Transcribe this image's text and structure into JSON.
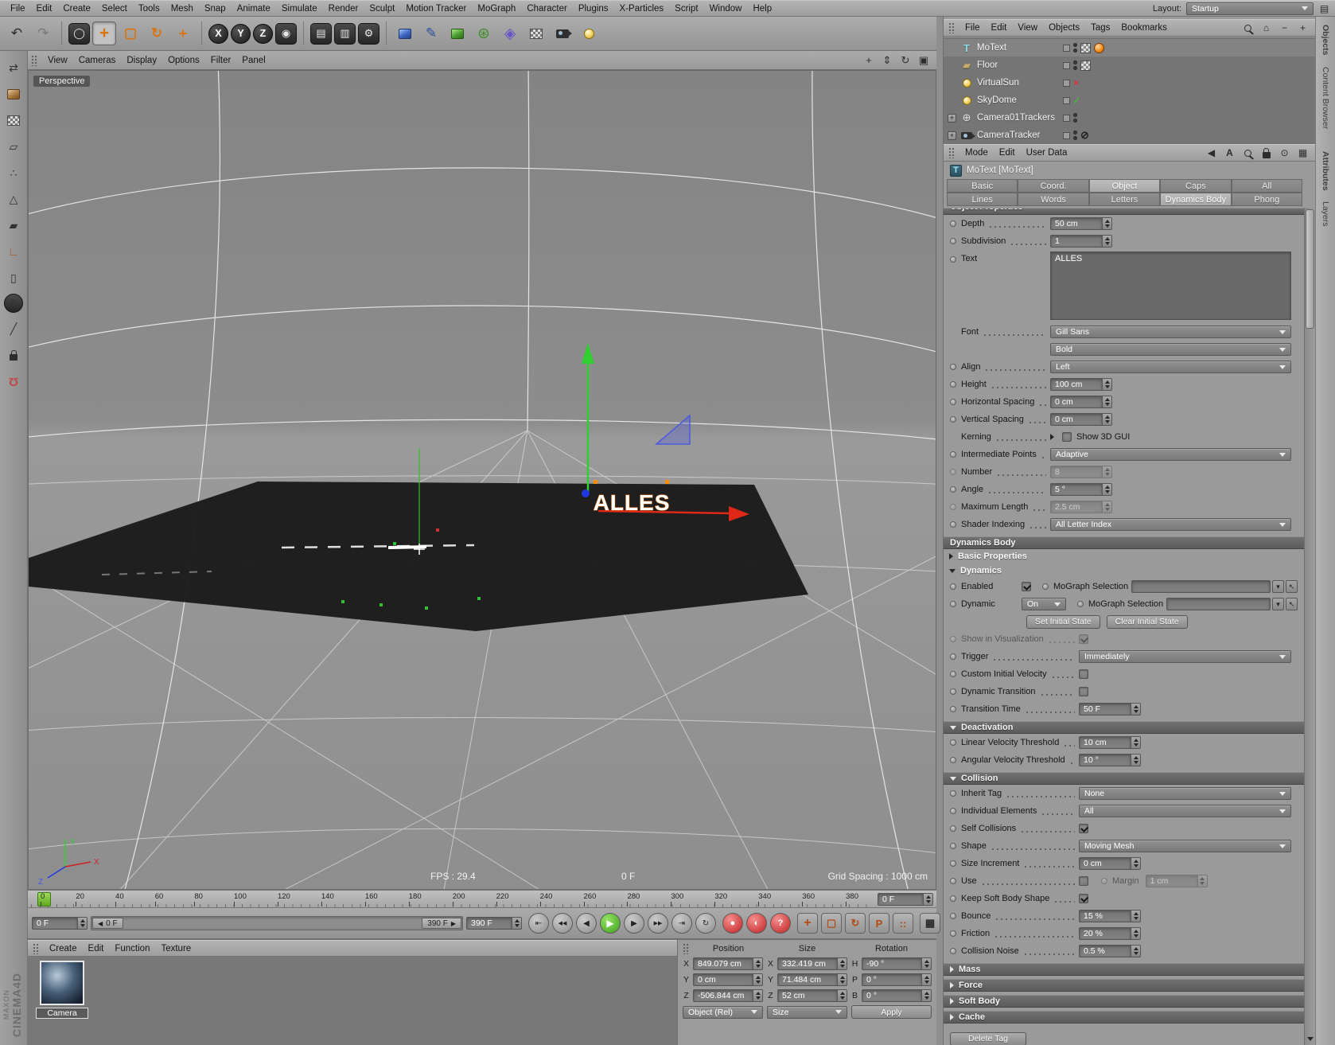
{
  "menubar": {
    "items": [
      "File",
      "Edit",
      "Create",
      "Select",
      "Tools",
      "Mesh",
      "Snap",
      "Animate",
      "Simulate",
      "Render",
      "Sculpt",
      "Motion Tracker",
      "MoGraph",
      "Character",
      "Plugins",
      "X-Particles",
      "Script",
      "Window",
      "Help"
    ],
    "layout_label": "Layout:",
    "layout_value": "Startup"
  },
  "toolbar": {
    "axis_x": "X",
    "axis_y": "Y",
    "axis_z": "Z",
    "icons": [
      "undo",
      "redo",
      "live-selection",
      "move-tool",
      "scale-tool",
      "rotate-tool",
      "last-tool",
      "x-axis-lock",
      "y-axis-lock",
      "z-axis-lock",
      "coordinate-system",
      "render-view",
      "render-to-picture-viewer",
      "edit-render-settings",
      "add-primitive",
      "add-spline",
      "add-generator",
      "add-mograph",
      "add-deformer",
      "add-environment",
      "add-camera",
      "add-light"
    ]
  },
  "left_palette": {
    "icons": [
      "make-editable",
      "model-mode",
      "texture-mode",
      "workplane-mode",
      "points-mode",
      "edges-mode",
      "polygons-mode",
      "axis-mode",
      "viewport-solo",
      "snap",
      "knife",
      "lock",
      "magnet-snap"
    ]
  },
  "viewport": {
    "menus": [
      "View",
      "Cameras",
      "Display",
      "Options",
      "Filter",
      "Panel"
    ],
    "view_label": "Perspective",
    "object_text": "ALLES",
    "fps": "FPS : 29.4",
    "frame": "0 F",
    "grid_spacing": "Grid Spacing : 1000 cm",
    "axis_x": "X",
    "axis_y": "Y",
    "axis_z": "Z"
  },
  "timeline": {
    "ticks": [
      "0",
      "20",
      "40",
      "60",
      "80",
      "100",
      "120",
      "140",
      "160",
      "180",
      "200",
      "220",
      "240",
      "260",
      "280",
      "300",
      "320",
      "340",
      "360",
      "380"
    ],
    "ruler_current": "0 F",
    "current_frame": "0 F",
    "range_start": "0 F",
    "range_end": "390 F",
    "duration": "390 F",
    "transport": [
      "goto-start",
      "previous-key",
      "previous-frame",
      "play-forward",
      "next-frame",
      "next-key",
      "goto-end",
      "loop"
    ],
    "record": [
      "record-keyframe",
      "autokeying",
      "keyframe-help"
    ],
    "record_toggles": [
      "record-position",
      "record-scale",
      "record-rotation",
      "record-parameter",
      "record-pla"
    ]
  },
  "material_manager": {
    "menus": [
      "Create",
      "Edit",
      "Function",
      "Texture"
    ],
    "materials": [
      {
        "name": "Camera"
      }
    ]
  },
  "coordinates": {
    "position": {
      "title": "Position",
      "x_label": "X",
      "x": "849.079 cm",
      "y_label": "Y",
      "y": "0 cm",
      "z_label": "Z",
      "z": "-506.844 cm",
      "mode": "Object (Rel)"
    },
    "size": {
      "title": "Size",
      "x_label": "X",
      "x": "332.419 cm",
      "y_label": "Y",
      "y": "71.484 cm",
      "z_label": "Z",
      "z": "52 cm",
      "mode": "Size"
    },
    "rotation": {
      "title": "Rotation",
      "h_label": "H",
      "h": "-90 °",
      "p_label": "P",
      "p": "0 °",
      "b_label": "B",
      "b": "0 °",
      "apply": "Apply"
    }
  },
  "object_manager": {
    "menus": [
      "File",
      "Edit",
      "View",
      "Objects",
      "Tags",
      "Bookmarks"
    ],
    "objects": [
      {
        "name": "MoText"
      },
      {
        "name": "Floor"
      },
      {
        "name": "VirtualSun"
      },
      {
        "name": "SkyDome"
      },
      {
        "name": "Camera01Trackers"
      },
      {
        "name": "CameraTracker"
      }
    ]
  },
  "attributes": {
    "menus": [
      "Mode",
      "Edit",
      "User Data"
    ],
    "title": "MoText [MoText]",
    "tabs": {
      "t1": "Basic",
      "t2": "Coord.",
      "t3": "Object",
      "t4": "Caps",
      "t5": "All",
      "t6": "Lines",
      "t7": "Words",
      "t8": "Letters",
      "t9": "Dynamics Body",
      "t10": "Phong"
    },
    "object_properties": {
      "section": "Object Properties",
      "depth_label": "Depth",
      "depth": "50 cm",
      "subdivision_label": "Subdivision",
      "subdivision": "1",
      "text_label": "Text",
      "text": "ALLES",
      "font_label": "Font",
      "font_name": "Gill Sans",
      "font_style": "Bold",
      "align_label": "Align",
      "align": "Left",
      "height_label": "Height",
      "height": "100 cm",
      "hspacing_label": "Horizontal Spacing",
      "hspacing": "0 cm",
      "vspacing_label": "Vertical Spacing",
      "vspacing": "0 cm",
      "kerning_label": "Kerning",
      "show_3d_gui_label": "Show 3D GUI",
      "intermediate_label": "Intermediate Points",
      "intermediate": "Adaptive",
      "number_label": "Number",
      "number": "8",
      "angle_label": "Angle",
      "angle": "5 °",
      "max_length_label": "Maximum Length",
      "max_length": "2.5 cm",
      "shader_label": "Shader Indexing",
      "shader": "All Letter Index"
    },
    "dynamics": {
      "section": "Dynamics Body",
      "basic_properties": "Basic Properties",
      "dynamics_sub": "Dynamics",
      "enabled_label": "Enabled",
      "mograph_selection_label": "MoGraph Selection",
      "dynamic_label": "Dynamic",
      "dynamic_value": "On",
      "mograph_selection2_label": "MoGraph Selection",
      "set_initial_state": "Set Initial State",
      "clear_initial_state": "Clear Initial State",
      "show_viz_label": "Show in Visualization",
      "trigger_label": "Trigger",
      "trigger": "Immediately",
      "custom_velocity_label": "Custom Initial Velocity",
      "dynamic_transition_label": "Dynamic Transition",
      "transition_time_label": "Transition Time",
      "transition_time": "50 F"
    },
    "deactivation": {
      "section": "Deactivation",
      "linear_label": "Linear Velocity Threshold",
      "linear": "10 cm",
      "angular_label": "Angular Velocity Threshold",
      "angular": "10 °"
    },
    "collision": {
      "section": "Collision",
      "inherit_label": "Inherit Tag",
      "inherit": "None",
      "individual_label": "Individual Elements",
      "individual": "All",
      "self_label": "Self Collisions",
      "shape_label": "Shape",
      "shape": "Moving Mesh",
      "size_increment_label": "Size Increment",
      "size_increment": "0 cm",
      "use_label": "Use",
      "margin_label": "Margin",
      "margin": "1 cm",
      "keep_shape_label": "Keep Soft Body Shape",
      "bounce_label": "Bounce",
      "bounce": "15 %",
      "friction_label": "Friction",
      "friction": "20 %",
      "noise_label": "Collision Noise",
      "noise": "0.5 %"
    },
    "collapsed": [
      "Mass",
      "Force",
      "Soft Body",
      "Cache"
    ],
    "delete_tag": "Delete Tag"
  },
  "right_tabs": {
    "items": [
      "Objects",
      "Content Browser",
      "Attributes",
      "Layers"
    ]
  },
  "branding": {
    "line1": "MAXON",
    "line2": "CINEMA4D"
  }
}
